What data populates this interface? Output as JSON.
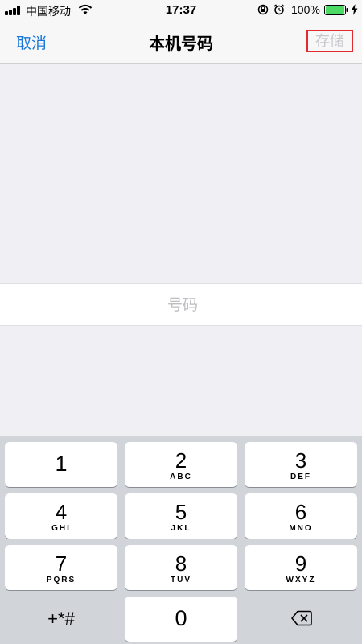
{
  "status_bar": {
    "carrier": "中国移动",
    "time": "17:37",
    "battery_percent": "100%",
    "battery_level": 1.0
  },
  "nav": {
    "cancel_label": "取消",
    "title": "本机号码",
    "save_label": "存储"
  },
  "number_field": {
    "placeholder": "号码",
    "value": ""
  },
  "keypad": {
    "keys": [
      {
        "digit": "1",
        "letters": ""
      },
      {
        "digit": "2",
        "letters": "ABC"
      },
      {
        "digit": "3",
        "letters": "DEF"
      },
      {
        "digit": "4",
        "letters": "GHI"
      },
      {
        "digit": "5",
        "letters": "JKL"
      },
      {
        "digit": "6",
        "letters": "MNO"
      },
      {
        "digit": "7",
        "letters": "PQRS"
      },
      {
        "digit": "8",
        "letters": "TUV"
      },
      {
        "digit": "9",
        "letters": "WXYZ"
      }
    ],
    "symbols_label": "+*#",
    "zero": "0"
  },
  "colors": {
    "accent": "#1a78d9",
    "highlight_box": "#e02c2c",
    "battery": "#4cd964"
  }
}
